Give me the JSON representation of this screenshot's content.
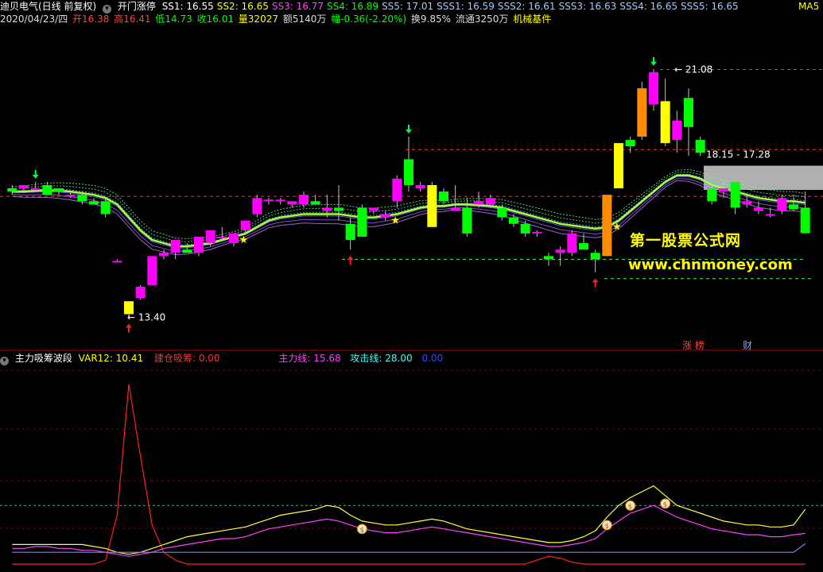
{
  "header": {
    "title": "迪贝电气(日线 前复权)",
    "indicator_name": "开门涨停",
    "ss": [
      {
        "label": "SS1: 16.55",
        "color": "#ffffff"
      },
      {
        "label": "SS2: 16.65",
        "color": "#ffff00"
      },
      {
        "label": "SS3: 16.77",
        "color": "#ff40ff"
      },
      {
        "label": "SS4: 16.89",
        "color": "#00ff00"
      },
      {
        "label": "SS5: 17.01",
        "color": "#9ccbff"
      },
      {
        "label": "SSS1: 16.59",
        "color": "#9ccbff"
      },
      {
        "label": "SSS2: 16.61",
        "color": "#9ccbff"
      },
      {
        "label": "SSS3: 16.63",
        "color": "#9ccbff"
      },
      {
        "label": "SSS4: 16.65",
        "color": "#9ccbff"
      },
      {
        "label": "SSS5: 16.65",
        "color": "#9ccbff"
      }
    ],
    "right_label": "MA5"
  },
  "quote": {
    "date": "2020/04/23/四",
    "open": "开16.38",
    "high": "高16.41",
    "low": "低14.73",
    "close": "收16.01",
    "volume": "量32027",
    "amount": "额5140万",
    "change": "幅-0.36(-2.20%)",
    "turnover": "换9.85%",
    "float": "流通3250万",
    "sector": "机械基件"
  },
  "price_labels": {
    "high": "21.08",
    "low": "13.40",
    "range": "18.15 - 17.28"
  },
  "badges": {
    "zhang": "涨",
    "bang": "榜",
    "cai": "财"
  },
  "watermark": {
    "line1": "第一股票公式网",
    "line2": "www.chnmoney.com"
  },
  "sub_header": {
    "title": "主力吸筹波段",
    "var12": "VAR12: 10.41",
    "jiancang": "建仓吸筹: 0.00",
    "zhuli": "主力线: 15.68",
    "gongji": "攻击线: 28.00",
    "extra": "0.00"
  },
  "colors": {
    "up": "#ff00ff",
    "down": "#00ff00",
    "accent": "#ffff00",
    "divider": "#b00000"
  },
  "chart_data": {
    "type": "candlestick",
    "note_x": "daily bars, oldest to newest",
    "ylim": [
      12.6,
      22.3
    ],
    "candles": [
      {
        "o": 17.4,
        "h": 17.5,
        "l": 17.2,
        "c": 17.3
      },
      {
        "o": 17.4,
        "h": 17.5,
        "l": 17.3,
        "c": 17.5
      },
      {
        "o": 17.4,
        "h": 17.6,
        "l": 17.3,
        "c": 17.4
      },
      {
        "o": 17.5,
        "h": 17.6,
        "l": 17.2,
        "c": 17.2
      },
      {
        "o": 17.4,
        "h": 17.4,
        "l": 17.2,
        "c": 17.3
      },
      {
        "o": 17.2,
        "h": 17.3,
        "l": 17.1,
        "c": 17.2
      },
      {
        "o": 17.2,
        "h": 17.3,
        "l": 16.9,
        "c": 17.0
      },
      {
        "o": 17.0,
        "h": 17.1,
        "l": 16.9,
        "c": 16.9
      },
      {
        "o": 17.0,
        "h": 17.1,
        "l": 16.5,
        "c": 16.6
      },
      {
        "o": 15.1,
        "h": 15.2,
        "l": 15.1,
        "c": 15.15
      },
      {
        "o": 13.5,
        "h": 13.9,
        "l": 13.4,
        "c": 13.9
      },
      {
        "o": 14.0,
        "h": 14.4,
        "l": 13.95,
        "c": 14.35
      },
      {
        "o": 14.4,
        "h": 15.3,
        "l": 14.4,
        "c": 15.3
      },
      {
        "o": 15.3,
        "h": 15.5,
        "l": 15.2,
        "c": 15.4
      },
      {
        "o": 15.4,
        "h": 15.8,
        "l": 15.2,
        "c": 15.8
      },
      {
        "o": 15.5,
        "h": 15.7,
        "l": 15.4,
        "c": 15.4
      },
      {
        "o": 15.4,
        "h": 15.9,
        "l": 15.3,
        "c": 15.9
      },
      {
        "o": 15.7,
        "h": 16.1,
        "l": 15.6,
        "c": 16.1
      },
      {
        "o": 15.9,
        "h": 16.2,
        "l": 15.8,
        "c": 15.9
      },
      {
        "o": 15.7,
        "h": 16.0,
        "l": 15.6,
        "c": 16.0
      },
      {
        "o": 16.1,
        "h": 16.4,
        "l": 16.0,
        "c": 16.4
      },
      {
        "o": 16.6,
        "h": 17.2,
        "l": 16.5,
        "c": 17.1
      },
      {
        "o": 17.0,
        "h": 17.1,
        "l": 16.9,
        "c": 17.05
      },
      {
        "o": 17.0,
        "h": 17.1,
        "l": 16.9,
        "c": 17.05
      },
      {
        "o": 16.9,
        "h": 17.0,
        "l": 16.8,
        "c": 17.0
      },
      {
        "o": 16.9,
        "h": 17.3,
        "l": 16.8,
        "c": 17.2
      },
      {
        "o": 17.0,
        "h": 17.2,
        "l": 16.9,
        "c": 16.9
      },
      {
        "o": 16.7,
        "h": 17.2,
        "l": 16.5,
        "c": 16.8
      },
      {
        "o": 16.8,
        "h": 17.5,
        "l": 16.4,
        "c": 16.7
      },
      {
        "o": 16.3,
        "h": 16.5,
        "l": 15.5,
        "c": 15.8
      },
      {
        "o": 16.8,
        "h": 16.9,
        "l": 15.9,
        "c": 15.9
      },
      {
        "o": 16.7,
        "h": 16.8,
        "l": 16.6,
        "c": 16.8
      },
      {
        "o": 16.5,
        "h": 16.7,
        "l": 16.4,
        "c": 16.6
      },
      {
        "o": 17.0,
        "h": 17.8,
        "l": 16.8,
        "c": 17.7
      },
      {
        "o": 18.3,
        "h": 19.0,
        "l": 17.3,
        "c": 17.5
      },
      {
        "o": 17.4,
        "h": 17.6,
        "l": 17.3,
        "c": 17.5
      },
      {
        "o": 17.5,
        "h": 17.6,
        "l": 16.2,
        "c": 16.2
      },
      {
        "o": 17.3,
        "h": 17.4,
        "l": 16.9,
        "c": 17.0
      },
      {
        "o": 16.7,
        "h": 17.5,
        "l": 16.7,
        "c": 16.8
      },
      {
        "o": 16.8,
        "h": 17.1,
        "l": 15.9,
        "c": 16.0
      },
      {
        "o": 16.9,
        "h": 17.3,
        "l": 16.8,
        "c": 17.0
      },
      {
        "o": 16.9,
        "h": 17.2,
        "l": 16.8,
        "c": 17.1
      },
      {
        "o": 16.8,
        "h": 16.9,
        "l": 16.4,
        "c": 16.5
      },
      {
        "o": 16.5,
        "h": 16.6,
        "l": 16.2,
        "c": 16.3
      },
      {
        "o": 16.3,
        "h": 16.4,
        "l": 15.9,
        "c": 16.0
      },
      {
        "o": 16.0,
        "h": 16.1,
        "l": 15.9,
        "c": 16.05
      },
      {
        "o": 15.3,
        "h": 15.4,
        "l": 15.0,
        "c": 15.2
      },
      {
        "o": 15.4,
        "h": 15.6,
        "l": 15.0,
        "c": 15.5
      },
      {
        "o": 15.4,
        "h": 16.1,
        "l": 15.3,
        "c": 16.0
      },
      {
        "o": 15.7,
        "h": 16.0,
        "l": 15.5,
        "c": 15.5
      },
      {
        "o": 15.4,
        "h": 15.5,
        "l": 14.8,
        "c": 15.2
      },
      {
        "o": 15.3,
        "h": 17.2,
        "l": 15.3,
        "c": 17.2
      },
      {
        "o": 17.4,
        "h": 18.8,
        "l": 17.4,
        "c": 18.8
      },
      {
        "o": 18.9,
        "h": 19.0,
        "l": 18.5,
        "c": 18.7
      },
      {
        "o": 19.0,
        "h": 20.7,
        "l": 18.9,
        "c": 20.5
      },
      {
        "o": 20.0,
        "h": 21.1,
        "l": 19.8,
        "c": 21.0
      },
      {
        "o": 20.1,
        "h": 20.8,
        "l": 18.7,
        "c": 18.8
      },
      {
        "o": 18.9,
        "h": 19.8,
        "l": 18.5,
        "c": 19.5
      },
      {
        "o": 20.2,
        "h": 20.5,
        "l": 18.4,
        "c": 19.3
      },
      {
        "o": 18.9,
        "h": 19.0,
        "l": 18.4,
        "c": 18.5
      },
      {
        "o": 17.4,
        "h": 17.5,
        "l": 16.9,
        "c": 17.0
      },
      {
        "o": 17.3,
        "h": 17.6,
        "l": 17.1,
        "c": 17.4
      },
      {
        "o": 17.6,
        "h": 17.7,
        "l": 16.6,
        "c": 16.8
      },
      {
        "o": 16.9,
        "h": 17.2,
        "l": 16.8,
        "c": 17.0
      },
      {
        "o": 16.7,
        "h": 17.0,
        "l": 16.6,
        "c": 16.8
      },
      {
        "o": 16.6,
        "h": 16.8,
        "l": 16.5,
        "c": 16.6
      },
      {
        "o": 16.7,
        "h": 17.2,
        "l": 16.6,
        "c": 17.1
      },
      {
        "o": 16.9,
        "h": 17.2,
        "l": 16.7,
        "c": 16.75
      },
      {
        "o": 16.8,
        "h": 17.3,
        "l": 16.0,
        "c": 16.01
      }
    ],
    "ma_bundle": [
      17.3,
      17.3,
      17.32,
      17.34,
      17.33,
      17.3,
      17.25,
      17.2,
      17.1,
      16.9,
      16.5,
      16.1,
      15.8,
      15.7,
      15.6,
      15.6,
      15.65,
      15.7,
      15.8,
      15.9,
      16.0,
      16.2,
      16.4,
      16.5,
      16.55,
      16.6,
      16.6,
      16.6,
      16.6,
      16.55,
      16.5,
      16.5,
      16.55,
      16.6,
      16.7,
      16.8,
      16.85,
      16.85,
      16.9,
      16.9,
      16.88,
      16.85,
      16.8,
      16.7,
      16.6,
      16.5,
      16.4,
      16.3,
      16.25,
      16.2,
      16.15,
      16.2,
      16.4,
      16.7,
      17.0,
      17.3,
      17.6,
      17.8,
      17.8,
      17.7,
      17.5,
      17.4,
      17.3,
      17.2,
      17.1,
      17.05,
      17.0,
      17.0,
      16.95
    ],
    "markers": {
      "up_arrows": [
        10,
        29,
        50
      ],
      "down_arrows": [
        2,
        34,
        55
      ],
      "star_B": [
        20,
        33,
        52
      ]
    },
    "sub_ylim": [
      0,
      100
    ],
    "sub_series": [
      {
        "name": "建仓吸筹",
        "color": "#ff2020",
        "values": [
          0,
          0,
          0,
          0,
          0,
          0,
          0,
          0,
          2,
          25,
          92,
          55,
          20,
          6,
          2,
          0,
          0,
          0,
          0,
          0,
          0,
          0,
          0,
          0,
          0,
          0,
          0,
          0,
          0,
          0,
          0,
          0,
          0,
          0,
          0,
          0,
          0,
          0,
          0,
          0,
          0,
          0,
          0,
          0,
          0,
          2,
          4,
          3,
          1,
          0,
          0,
          0,
          0,
          0,
          0,
          0,
          0,
          0,
          0,
          0,
          0,
          0,
          0,
          0,
          0,
          0,
          0,
          0,
          0
        ]
      },
      {
        "name": "主力线",
        "color": "#ff40ff",
        "values": [
          8,
          8,
          9,
          9,
          8,
          8,
          7,
          7,
          6,
          5,
          4,
          5,
          6,
          8,
          9,
          10,
          11,
          12,
          13,
          13,
          14,
          16,
          18,
          19,
          20,
          21,
          22,
          23,
          22,
          20,
          18,
          17,
          16,
          16,
          17,
          18,
          19,
          18,
          17,
          16,
          15,
          14,
          13,
          12,
          11,
          10,
          9,
          9,
          10,
          11,
          13,
          18,
          22,
          26,
          28,
          30,
          27,
          24,
          22,
          20,
          18,
          17,
          16,
          15,
          15,
          14,
          14,
          15,
          15.68
        ]
      },
      {
        "name": "攻击线",
        "color": "#ffff40",
        "values": [
          10,
          10,
          10,
          10,
          10,
          10,
          10,
          9,
          8,
          6,
          5,
          6,
          8,
          10,
          12,
          14,
          15,
          16,
          17,
          18,
          19,
          21,
          23,
          25,
          26,
          27,
          28,
          30,
          29,
          25,
          22,
          21,
          20,
          20,
          21,
          22,
          23,
          22,
          20,
          18,
          17,
          16,
          15,
          14,
          13,
          12,
          11,
          11,
          12,
          14,
          17,
          24,
          30,
          34,
          37,
          40,
          35,
          30,
          28,
          26,
          24,
          22,
          21,
          20,
          20,
          19,
          19,
          20,
          28
        ]
      },
      {
        "name": "VAR12",
        "color": "#8080ff",
        "values": [
          6,
          6,
          6,
          6,
          6,
          6,
          6,
          6,
          6,
          6,
          6,
          6,
          6,
          6,
          6,
          6,
          6,
          6,
          6,
          6,
          6,
          6,
          6,
          6,
          6,
          6,
          6,
          6,
          6,
          6,
          6,
          6,
          6,
          6,
          6,
          6,
          6,
          6,
          6,
          6,
          6,
          6,
          6,
          6,
          6,
          6,
          6,
          6,
          6,
          6,
          6,
          6,
          6,
          6,
          6,
          6,
          6,
          6,
          6,
          6,
          6,
          6,
          6,
          6,
          6,
          6,
          6,
          6,
          10.41
        ]
      }
    ],
    "money_bags": [
      30,
      51,
      53,
      56
    ]
  }
}
